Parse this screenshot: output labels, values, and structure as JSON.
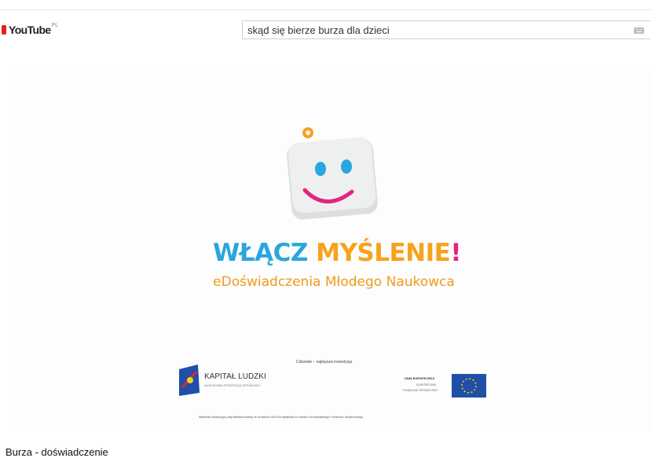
{
  "header": {
    "logo_text": "YouTube",
    "logo_superscript": "PL",
    "search_value": "skąd się bierze burza dla dzieci"
  },
  "video": {
    "headline_part1": "WŁĄCZ ",
    "headline_part2": "MYŚLENIE",
    "headline_exclaim": "!",
    "subtitle": "eDoświadczenia Młodego Naukowca",
    "sponsor_motto": "Człowiek – najlepsza inwestycja",
    "kl_title": "KAPITAŁ LUDZKI",
    "kl_subtitle": "NARODOWA STRATEGIA SPÓJNOŚCI",
    "eu_title": "UNIA EUROPEJSKA",
    "eu_line2": "EUROPEJSKI",
    "eu_line3": "FUNDUSZ SPOŁECZNY",
    "funding_note": "Materiał edukacyjny współfinansowany ze środków Unii Europejskiej w ramach Europejskiego Funduszu Społecznego"
  },
  "below": {
    "title": "Burza - doświadczenie"
  },
  "colors": {
    "brand_red": "#e62117",
    "headline_blue": "#2aa6de",
    "headline_orange": "#f7a21b",
    "accent_pink": "#e2267f",
    "eu_blue": "#1f4fa8",
    "eu_star": "#ffdd00"
  },
  "icons": [
    "youtube-logo",
    "keyboard-icon",
    "gear-icon",
    "smiley-face-icon",
    "kapital-ludzki-logo",
    "eu-flag-icon"
  ]
}
